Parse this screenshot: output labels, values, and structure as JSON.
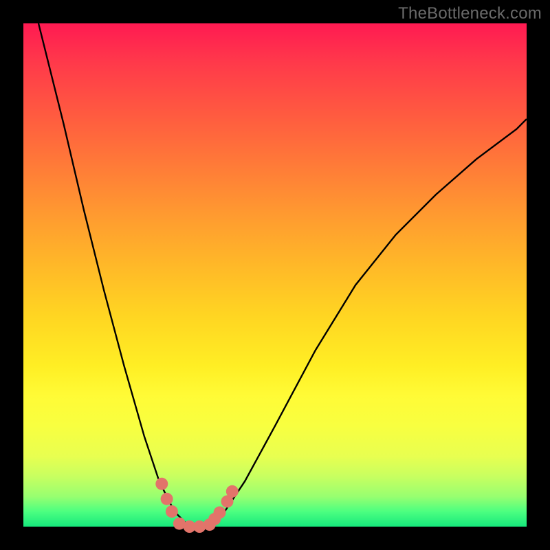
{
  "watermark": "TheBottleneck.com",
  "chart_data": {
    "type": "line",
    "title": "",
    "xlabel": "",
    "ylabel": "",
    "xlim": [
      0,
      100
    ],
    "ylim": [
      0,
      100
    ],
    "series": [
      {
        "name": "bottleneck-curve",
        "x": [
          3,
          8,
          12,
          16,
          20,
          24,
          27,
          30,
          32,
          33,
          34,
          35,
          36,
          37,
          38,
          40,
          44,
          50,
          58,
          66,
          74,
          82,
          90,
          98,
          100
        ],
        "y": [
          100,
          80,
          63,
          47,
          32,
          18,
          9,
          3,
          1,
          0,
          0,
          0,
          0,
          0,
          1,
          3,
          9,
          20,
          35,
          48,
          58,
          66,
          73,
          79,
          81
        ]
      }
    ],
    "markers": [
      {
        "name": "marker",
        "x": 27.5,
        "y": 8.5
      },
      {
        "name": "marker",
        "x": 28.5,
        "y": 5.5
      },
      {
        "name": "marker",
        "x": 29.5,
        "y": 3.0
      },
      {
        "name": "marker",
        "x": 31.0,
        "y": 0.6
      },
      {
        "name": "marker",
        "x": 33.0,
        "y": 0.0
      },
      {
        "name": "marker",
        "x": 35.0,
        "y": 0.0
      },
      {
        "name": "marker",
        "x": 37.0,
        "y": 0.4
      },
      {
        "name": "marker",
        "x": 38.0,
        "y": 1.5
      },
      {
        "name": "marker",
        "x": 39.0,
        "y": 2.8
      },
      {
        "name": "marker",
        "x": 40.5,
        "y": 5.0
      },
      {
        "name": "marker",
        "x": 41.5,
        "y": 7.0
      }
    ],
    "background_gradient": {
      "top": "#ff1a52",
      "mid": "#ffee24",
      "bottom": "#16e87c"
    },
    "marker_color": "#e2746a",
    "curve_color": "#000000"
  }
}
